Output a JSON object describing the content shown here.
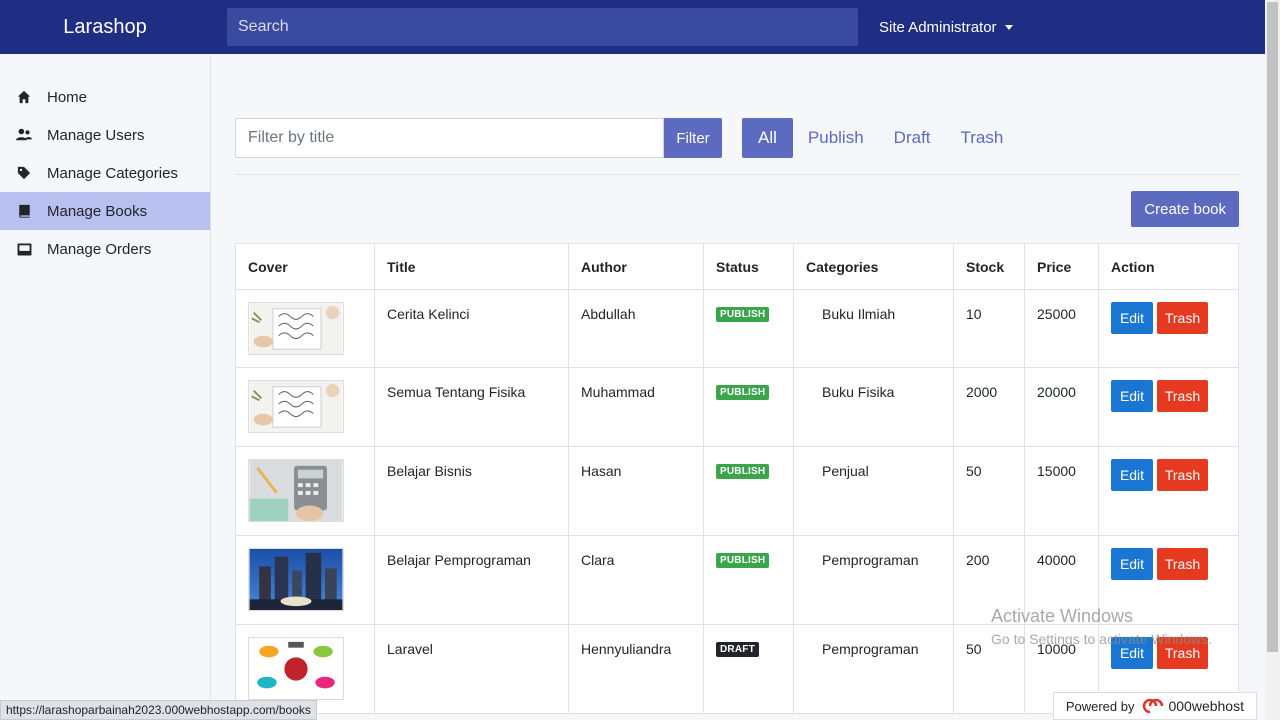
{
  "app": {
    "brand": "Larashop",
    "search_placeholder": "Search",
    "user_menu": "Site Administrator"
  },
  "sidebar": {
    "items": [
      {
        "label": "Home",
        "icon": "home-icon",
        "active": false
      },
      {
        "label": "Manage Users",
        "icon": "users-icon",
        "active": false
      },
      {
        "label": "Manage Categories",
        "icon": "tag-icon",
        "active": false
      },
      {
        "label": "Manage Books",
        "icon": "book-icon",
        "active": true
      },
      {
        "label": "Manage Orders",
        "icon": "inbox-icon",
        "active": false
      }
    ]
  },
  "filter": {
    "placeholder": "Filter by title",
    "button": "Filter",
    "tabs": [
      "All",
      "Publish",
      "Draft",
      "Trash"
    ],
    "active_tab": "All"
  },
  "create_button": "Create book",
  "table": {
    "headers": [
      "Cover",
      "Title",
      "Author",
      "Status",
      "Categories",
      "Stock",
      "Price",
      "Action"
    ],
    "rows": [
      {
        "title": "Cerita Kelinci",
        "author": "Abdullah",
        "status": "PUBLISH",
        "category": "Buku Ilmiah",
        "stock": "10",
        "price": "25000"
      },
      {
        "title": "Semua Tentang Fisika",
        "author": "Muhammad",
        "status": "PUBLISH",
        "category": "Buku Fisika",
        "stock": "2000",
        "price": "20000"
      },
      {
        "title": "Belajar Bisnis",
        "author": "Hasan",
        "status": "PUBLISH",
        "category": "Penjual",
        "stock": "50",
        "price": "15000"
      },
      {
        "title": "Belajar Pemprograman",
        "author": "Clara",
        "status": "PUBLISH",
        "category": "Pemprograman",
        "stock": "200",
        "price": "40000"
      },
      {
        "title": "Laravel",
        "author": "Hennyuliandra",
        "status": "DRAFT",
        "category": "Pemprograman",
        "stock": "50",
        "price": "10000"
      }
    ],
    "edit_label": "Edit",
    "trash_label": "Trash"
  },
  "status_url": "https://larashoparbainah2023.000webhostapp.com/books",
  "watermark": {
    "line1": "Activate Windows",
    "line2": "Go to Settings to activate Windows."
  },
  "powered": {
    "label": "Powered by",
    "brand": "000webhost"
  },
  "colors": {
    "navbar": "#1f2d83",
    "accent": "#5c6bc0",
    "sidebar_active": "#b8c0ef",
    "edit": "#1976d2",
    "trash": "#e53a1f",
    "publish_badge": "#3aa54a",
    "draft_badge": "#212529"
  }
}
